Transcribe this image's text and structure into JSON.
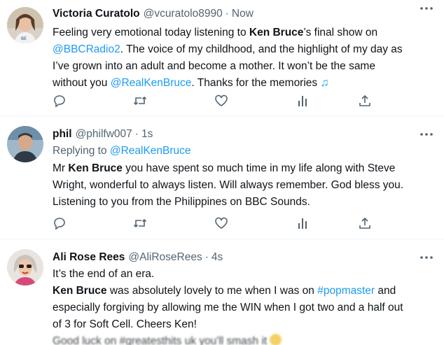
{
  "tweets": [
    {
      "name": "Victoria Curatolo",
      "handle": "@vcuratolo8990",
      "time": "Now",
      "lines": [
        [
          "Feeling very emotional today listening to ",
          "Ken Bruce",
          "’s final show on"
        ],
        [
          "@BBCRadio2",
          ". The voice of my childhood, and the highlight of my day as"
        ],
        [
          "I’ve grown into an adult and become a mother. It won’t be the same"
        ],
        [
          "without you ",
          "@RealKenBruce",
          ". Thanks for the memories "
        ]
      ],
      "actions": [
        "reply-icon",
        "retweet-icon",
        "like-icon",
        "views-icon",
        "share-icon"
      ]
    },
    {
      "name": "phil",
      "handle": "@philfw007",
      "time": "1s",
      "replying_prefix": "Replying to ",
      "replying_to": "@RealKenBruce",
      "lines": [
        [
          "Mr ",
          "Ken Bruce",
          " you have spent so much time in my life along with Steve"
        ],
        [
          "Wright, wonderful to always listen. Will always remember. God bless you."
        ],
        [
          "Listening to you from the Philippines on BBC Sounds."
        ]
      ],
      "actions": [
        "reply-icon",
        "retweet-icon",
        "like-icon",
        "views-icon",
        "share-icon"
      ]
    },
    {
      "name": "Ali Rose Rees",
      "handle": "@AliRoseRees",
      "time": "4s",
      "lines": [
        [
          "It’s the end of an era."
        ],
        [
          "Ken Bruce",
          " was absolutely lovely to me when I was on ",
          "#popmaster",
          " and"
        ],
        [
          "especially forgiving by allowing me the WIN when I got two and a half out"
        ],
        [
          "of 3 for Soft Cell. Cheers Ken!"
        ],
        [
          "Good luck on #greatesthits uk you'll smash it"
        ]
      ]
    }
  ],
  "separator": "·",
  "colors": {
    "link": "#1d9bf0",
    "secondary": "#536471",
    "text": "#0f1419",
    "border": "#eff3f4"
  }
}
